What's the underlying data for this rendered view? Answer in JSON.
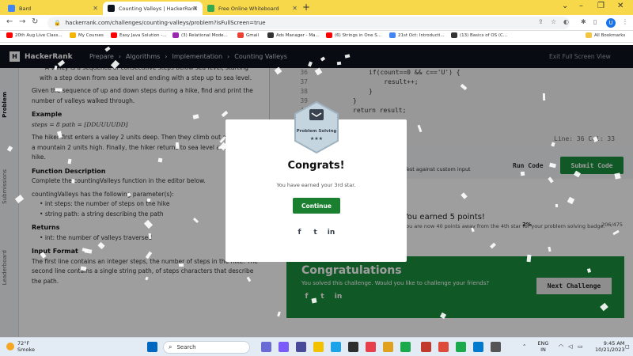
{
  "browser": {
    "tabs": [
      {
        "label": "Bard",
        "color": "#4285f4"
      },
      {
        "label": "Counting Valleys | HackerRank",
        "color": "#1ba94c"
      },
      {
        "label": "Free Online Whiteboard",
        "color": "#34a853"
      }
    ],
    "url": "hackerrank.com/challenges/counting-valleys/problem?isFullScreen=true",
    "profile_initial": "U",
    "bookmarks": [
      {
        "label": "20th Aug Live Class...",
        "color": "#ff0000"
      },
      {
        "label": "My Courses",
        "color": "#f4b400"
      },
      {
        "label": "Easy Java Solution -...",
        "color": "#ff0000"
      },
      {
        "label": "(3) Relational Mode...",
        "color": "#9c27b0"
      },
      {
        "label": "Gmail",
        "color": "#ea4335"
      },
      {
        "label": "Ads Manager - Ma...",
        "color": "#333333"
      },
      {
        "label": "(6) Strings in One S...",
        "color": "#ff0000"
      },
      {
        "label": "21st Oct: Introducti...",
        "color": "#4285f4"
      },
      {
        "label": "(13) Basics of OS (C...",
        "color": "#333333"
      }
    ],
    "all_bookmarks": "All Bookmarks"
  },
  "header": {
    "logo": "HackerRank",
    "breadcrumbs": [
      "Prepare",
      "Algorithms",
      "Implementation",
      "Counting Valleys"
    ],
    "exit_fullscreen": "Exit Full Screen View"
  },
  "side_tabs": [
    "Problem",
    "Submissions",
    "Leaderboard"
  ],
  "problem": {
    "intro": "A valley is a sequence of consecutive steps below sea level, starting with a step down from sea level and ending with a step up to sea level.",
    "task": "Given the sequence of up and down steps during a hike, find and print the number of valleys walked through.",
    "example_heading": "Example",
    "example_math": "steps = 8 path = [DDUUUUDD]",
    "example_text": "The hiker first enters a valley 2 units deep. Then they climb out and up onto a mountain 2 units high. Finally, the hiker returns to sea level and ends the hike.",
    "fd_heading": "Function Description",
    "fd_text": "Complete the countingValleys function in the editor below.",
    "fd_params": "countingValleys has the following parameter(s):",
    "params": [
      "int steps: the number of steps on the hike",
      "string path: a string describing the path"
    ],
    "returns_heading": "Returns",
    "returns": [
      "int: the number of valleys traversed"
    ],
    "input_heading": "Input Format",
    "input_text": "The first line contains an integer steps, the number of steps in the hike. The second line contains a single string path, of steps characters that describe the path."
  },
  "editor": {
    "lines": [
      {
        "n": "36",
        "t": "if(count==0 && c=='U') {"
      },
      {
        "n": "37",
        "t": "    result++;"
      },
      {
        "n": "38",
        "t": "}"
      },
      {
        "n": "39",
        "t": "}"
      },
      {
        "n": "40",
        "t": "return result;"
      }
    ],
    "status": "Line: 36 Col: 33",
    "custom_input": "Test against custom input",
    "run": "Run Code",
    "submit": "Submit Code"
  },
  "points": {
    "title": "You earned 5 points!",
    "sub": "You are now 40 points away from the 4th star for your problem solving badge.",
    "percent": "2%",
    "rank": "206/475"
  },
  "congrats_panel": {
    "title": "Congratulations",
    "sub": "You solved this challenge. Would you like to challenge your friends?",
    "next": "Next Challenge"
  },
  "modal": {
    "badge_label": "Problem Solving",
    "badge_stars": "★★★",
    "title": "Congrats!",
    "sub": "You have earned your 3rd star.",
    "cta": "Continue"
  },
  "social": {
    "facebook": "f",
    "twitter": "t",
    "linkedin": "in"
  },
  "taskbar": {
    "temp": "72°F",
    "weather": "Smoke",
    "search": "Search",
    "lang": "ENG",
    "region": "IN",
    "time": "9:45 AM",
    "date": "10/21/2023"
  },
  "colors": {
    "hr_green": "#1a8f3c",
    "hr_dark": "#0e141e",
    "chrome_yellow": "#f7d84a"
  }
}
